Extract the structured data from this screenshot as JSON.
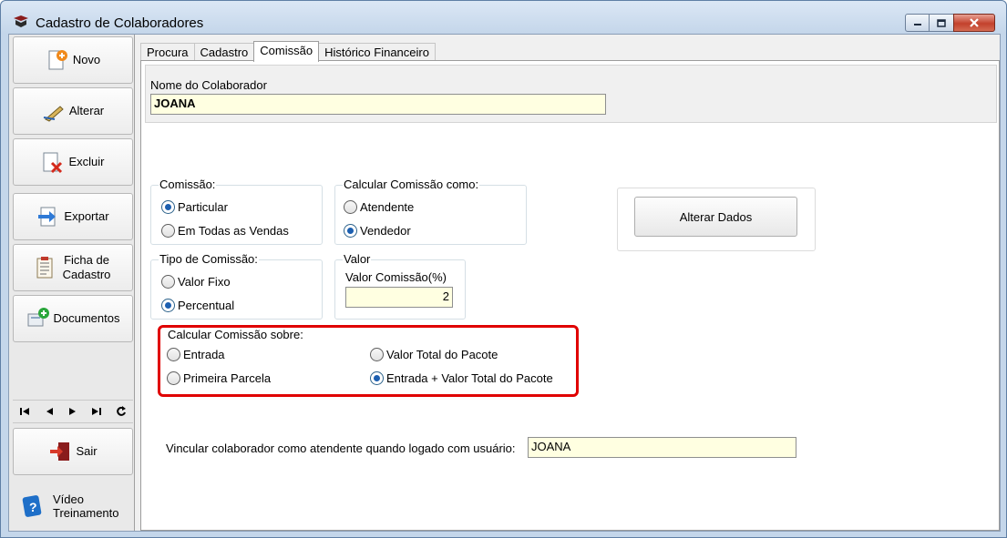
{
  "window": {
    "title": "Cadastro de Colaboradores",
    "icon": "app-logo-icon",
    "controls": [
      "minimize-icon",
      "maximize-icon",
      "close-icon"
    ]
  },
  "sidebar": {
    "novo": "Novo",
    "alterar": "Alterar",
    "excluir": "Excluir",
    "exportar": "Exportar",
    "ficha": "Ficha de Cadastro",
    "documentos": "Documentos",
    "sair": "Sair",
    "video": "Vídeo Treinamento",
    "nav": [
      "first-record-icon",
      "previous-record-icon",
      "next-record-icon",
      "last-record-icon",
      "refresh-icon"
    ]
  },
  "tabs": [
    "Procura",
    "Cadastro",
    "Comissão",
    "Histórico Financeiro"
  ],
  "active_tab": "Comissão",
  "form": {
    "nome_label": "Nome do Colaborador",
    "nome_value": "JOANA",
    "comissao": {
      "legend": "Comissão:",
      "opt1": "Particular",
      "opt2": "Em Todas as Vendas",
      "selected": "Particular"
    },
    "calcular_como": {
      "legend": "Calcular Comissão como:",
      "opt1": "Atendente",
      "opt2": "Vendedor",
      "selected": "Vendedor"
    },
    "tipo": {
      "legend": "Tipo de Comissão:",
      "opt1": "Valor Fixo",
      "opt2": "Percentual",
      "selected": "Percentual"
    },
    "valor": {
      "legend": "Valor",
      "label": "Valor Comissão(%)",
      "value": "2"
    },
    "calcular_sobre": {
      "legend": "Calcular Comissão sobre:",
      "opt1": "Entrada",
      "opt2": "Primeira Parcela",
      "opt3": "Valor Total do Pacote",
      "opt4": "Entrada + Valor Total do Pacote",
      "selected": "Entrada + Valor Total do Pacote"
    },
    "alterar_dados": "Alterar Dados",
    "vincular_label": "Vincular colaborador como atendente quando logado com usuário:",
    "vincular_value": "JOANA"
  },
  "colors": {
    "highlight": "#e00000",
    "input_bg": "#ffffe1",
    "radio_selected": "#1c5fb0",
    "window_frame": "#c4d6ea"
  }
}
